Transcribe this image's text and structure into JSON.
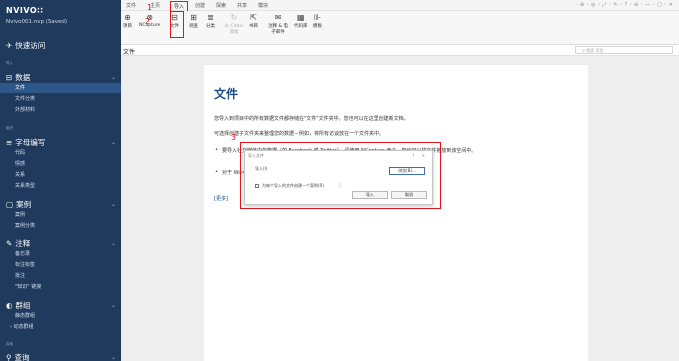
{
  "sidebar": {
    "logo": "NVIVO∷",
    "file_name": "Nvivo001.nvp (Saved)",
    "quick_access": "快速访问",
    "section_import": "导入",
    "data_group": "数据",
    "data_items": [
      "文件",
      "文件分类",
      "外部材料"
    ],
    "section_organize": "组织",
    "coding_group": "字母编写",
    "coding_items": [
      "代码",
      "情感",
      "关系",
      "关系类型"
    ],
    "cases_group": "案例",
    "cases_items": [
      "案例",
      "案例分类"
    ],
    "notes_group": "注释",
    "notes_items": [
      "备忘录",
      "标注标签",
      "批注",
      "\"知识\" 链接"
    ],
    "sets_group": "群组",
    "sets_items": [
      "静态群组",
      "动态群组"
    ],
    "section_explore": "探索",
    "query_group": "查询"
  },
  "ribbon_tabs": [
    "文件",
    "主页",
    "导入",
    "创建",
    "探索",
    "共享",
    "模块"
  ],
  "ribbon": {
    "buttons": [
      {
        "label": "项目",
        "icon": "⊕"
      },
      {
        "label": "NCapture",
        "icon": "⊗"
      },
      {
        "label": "文件",
        "icon": "⊟"
      },
      {
        "label": "调查",
        "icon": "⊞"
      },
      {
        "label": "分类",
        "icon": "≣"
      },
      {
        "label": "从 Citavi 添加",
        "icon": "↻"
      },
      {
        "label": "书目",
        "icon": "⇱"
      },
      {
        "label": "注释 & 电子邮件",
        "icon": "✉"
      },
      {
        "label": "代码库",
        "icon": "▦"
      },
      {
        "label": "模板",
        "icon": "⊪"
      }
    ]
  },
  "annotations": {
    "one": "1",
    "two": "2",
    "three": "3"
  },
  "breadcrumb": {
    "title": "文件",
    "search_placeholder": "搜索 项目"
  },
  "page": {
    "title": "文件",
    "p1": "您导入到项目中的所有数据文件都存储在\"文件\"文件夹中。您也可以在这里创建新文档。",
    "p2": "可选择创建子文件夹来整理您的数据－例如，将所有访谈放在一个文件夹中。",
    "bullet1": "要导入社交媒体中的数据（如 Facebook 或 Twitter），请使用 NCapture 命令。您也可以将文件拖放到该空间中。",
    "bullet2": "对于 Word 文档格式的注释资料 ，请单击 \"导入\" 选项卡上的\"收集 Office 文档\"命令。",
    "more": "[更多]"
  },
  "dialog": {
    "title": "导入文件",
    "label": "导入(I)",
    "browse": "浏览(B)...",
    "checkbox_label": "为每个导入的文件创建一个案例(R)",
    "help": "ⓘ",
    "ok": "导入",
    "cancel": "取消"
  }
}
